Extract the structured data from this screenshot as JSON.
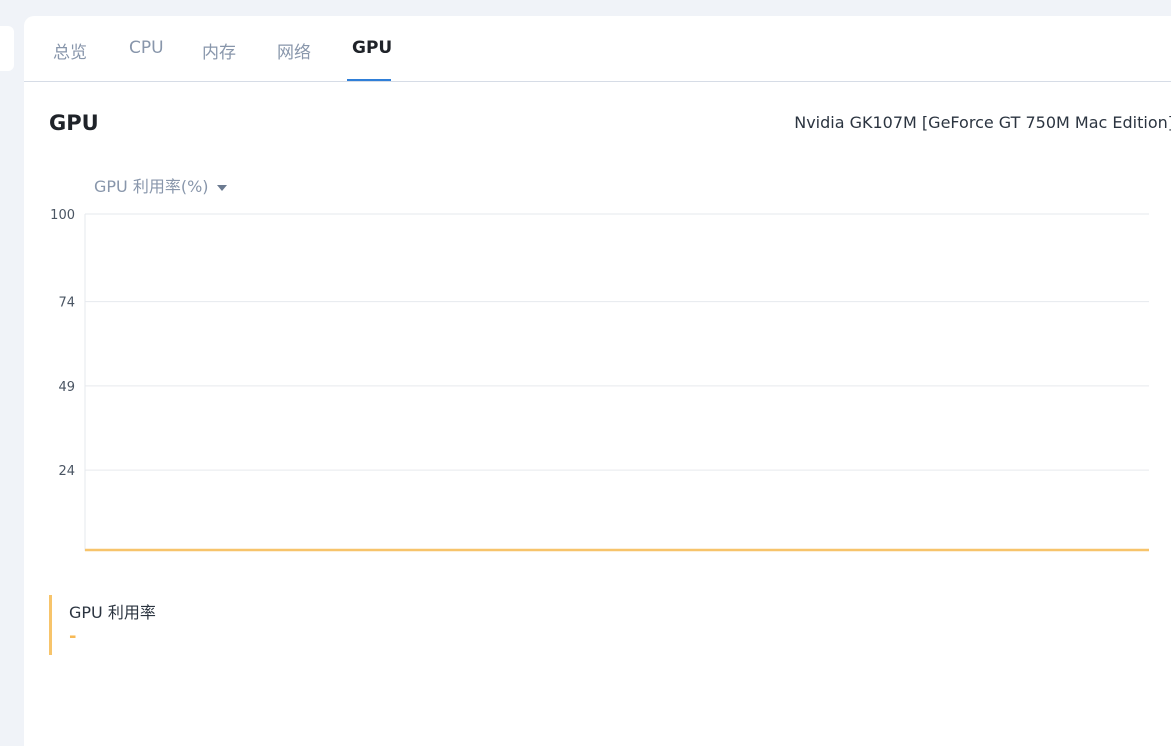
{
  "tabs": [
    {
      "label": "总览",
      "active": false
    },
    {
      "label": "CPU",
      "active": false
    },
    {
      "label": "内存",
      "active": false
    },
    {
      "label": "网络",
      "active": false
    },
    {
      "label": "GPU",
      "active": true
    }
  ],
  "section": {
    "title": "GPU",
    "gpu_model": "Nvidia GK107M [GeForce GT 750M Mac Edition]"
  },
  "metric_selector": {
    "selected": "GPU 利用率(%)",
    "icon": "caret-down-icon"
  },
  "legend": {
    "name": "GPU 利用率",
    "value": "-",
    "color": "#f7c46b"
  },
  "colors": {
    "accent": "#2f7fd8",
    "series": "#f7c46b",
    "muted_text": "#8896ab"
  },
  "chart_data": {
    "type": "line",
    "title": "",
    "xlabel": "",
    "ylabel": "",
    "ylim": [
      0,
      100
    ],
    "yticks": [
      24,
      49,
      74,
      100
    ],
    "grid": true,
    "series": [
      {
        "name": "GPU 利用率",
        "color": "#f7c46b",
        "values": [
          0,
          0
        ]
      }
    ]
  }
}
